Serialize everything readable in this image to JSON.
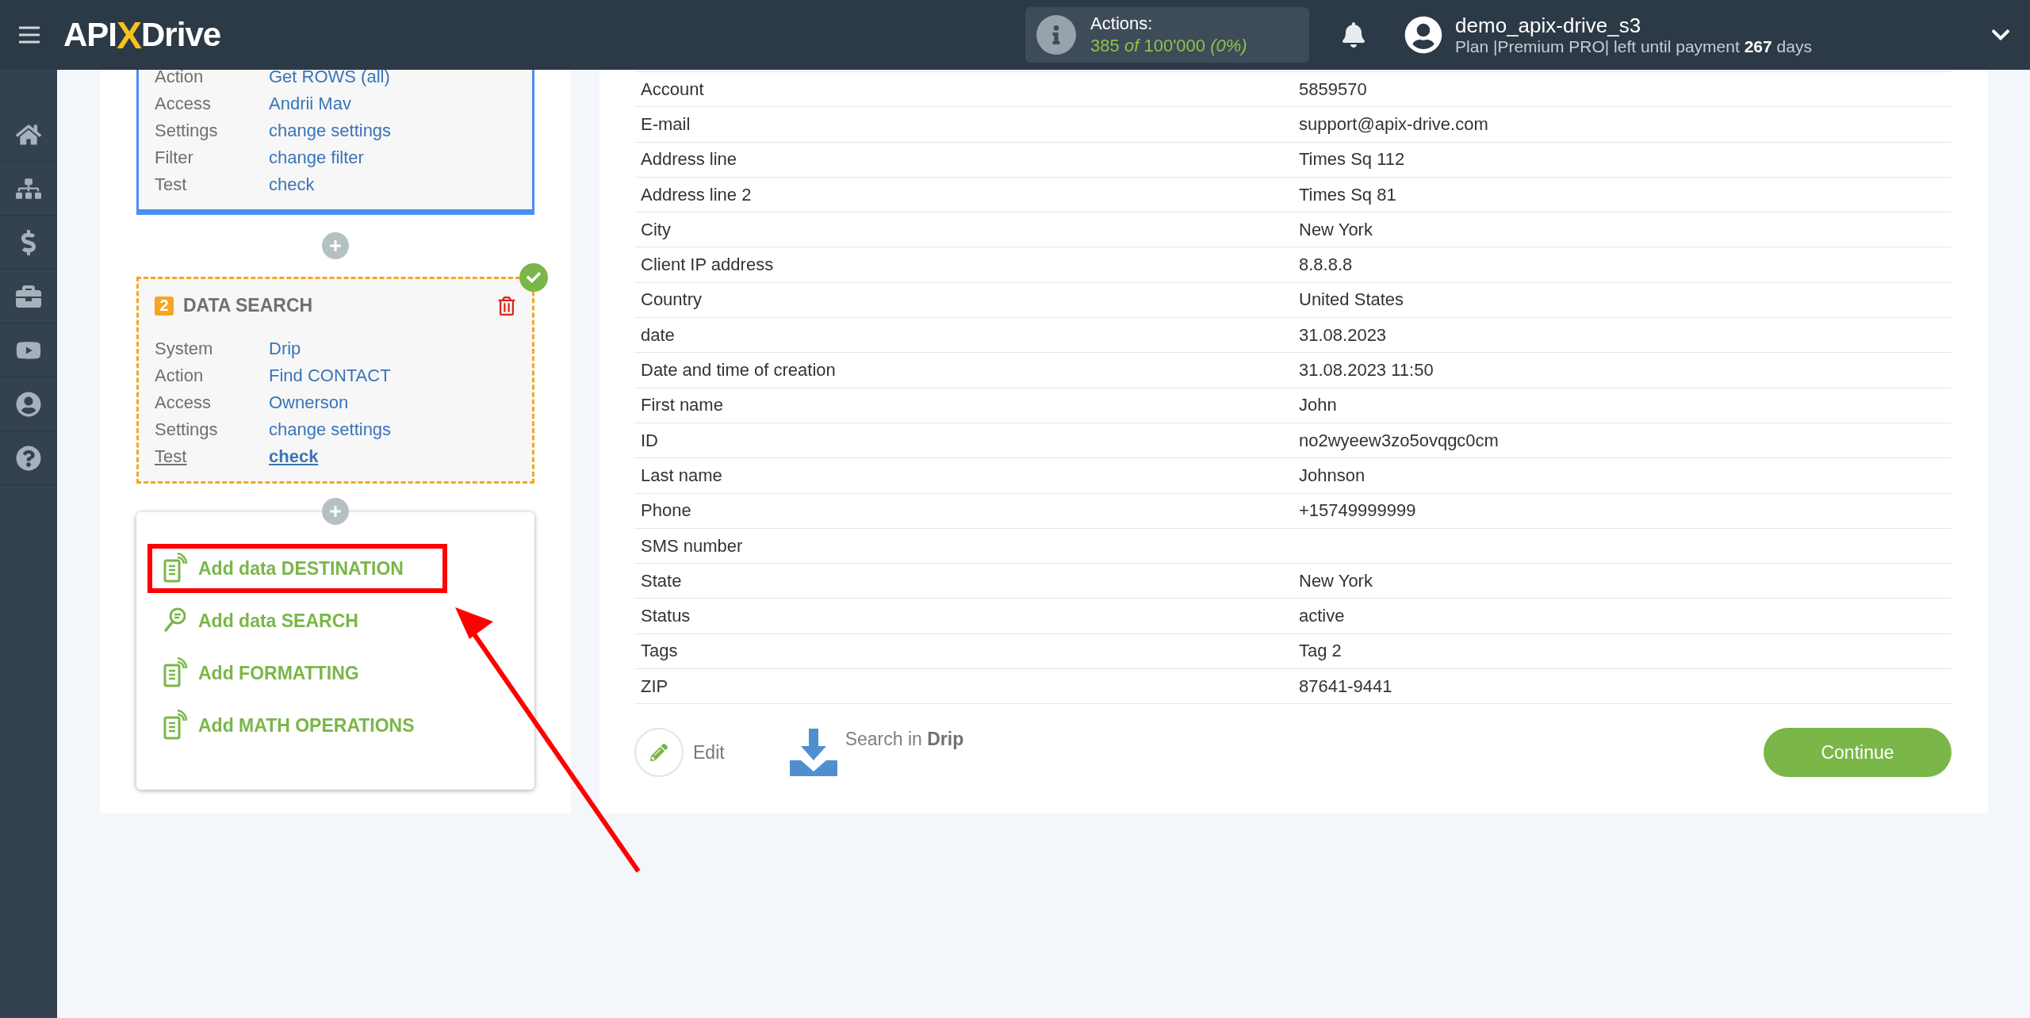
{
  "header": {
    "logo": {
      "left": "API",
      "mark": "X",
      "right": "Drive"
    },
    "actions": {
      "label": "Actions:",
      "used": "385",
      "of": "of",
      "total": "100'000",
      "percent": "(0%)"
    },
    "user": {
      "name": "demo_apix-drive_s3",
      "plan": "Plan |Premium PRO| left until payment **267** days"
    }
  },
  "sidebar": {
    "items": [
      {
        "kind": "home"
      },
      {
        "kind": "sitemap"
      },
      {
        "kind": "dollar"
      },
      {
        "kind": "briefcase"
      },
      {
        "kind": "video"
      },
      {
        "kind": "user"
      },
      {
        "kind": "help"
      }
    ]
  },
  "steps": [
    {
      "kind": "source",
      "rows": [
        {
          "label": "Action",
          "value": "Get ROWS (all)",
          "selected": false
        },
        {
          "label": "Access",
          "value": "Andrii Mav",
          "selected": false
        },
        {
          "label": "Settings",
          "value": "change settings",
          "selected": false
        },
        {
          "label": "Filter",
          "value": "change filter",
          "selected": false
        },
        {
          "label": "Test",
          "value": "check",
          "selected": false
        }
      ]
    },
    {
      "kind": "search",
      "number": "2",
      "title": "DATA SEARCH",
      "done": true,
      "rows": [
        {
          "label": "System",
          "value": "Drip",
          "selected": false
        },
        {
          "label": "Action",
          "value": "Find CONTACT",
          "selected": false
        },
        {
          "label": "Access",
          "value": "Ownerson",
          "selected": false
        },
        {
          "label": "Settings",
          "value": "change settings",
          "selected": false
        },
        {
          "label": "Test",
          "value": "check",
          "selected": true
        }
      ]
    }
  ],
  "add_menu": [
    {
      "kind": "document",
      "label": "Add data DESTINATION",
      "highlighted": true
    },
    {
      "kind": "search",
      "label": "Add data SEARCH",
      "highlighted": false
    },
    {
      "kind": "document",
      "label": "Add FORMATTING",
      "highlighted": false
    },
    {
      "kind": "document",
      "label": "Add MATH OPERATIONS",
      "highlighted": false
    }
  ],
  "table": {
    "rows": [
      {
        "field": "Account",
        "value": "5859570"
      },
      {
        "field": "E-mail",
        "value": "support@apix-drive.com"
      },
      {
        "field": "Address line",
        "value": "Times Sq 112"
      },
      {
        "field": "Address line 2",
        "value": "Times Sq 81"
      },
      {
        "field": "City",
        "value": "New York"
      },
      {
        "field": "Client IP address",
        "value": "8.8.8.8"
      },
      {
        "field": "Country",
        "value": "United States"
      },
      {
        "field": "date",
        "value": "31.08.2023"
      },
      {
        "field": "Date and time of creation",
        "value": "31.08.2023 11:50"
      },
      {
        "field": "First name",
        "value": "John"
      },
      {
        "field": "ID",
        "value": "no2wyeew3zo5ovqgc0cm"
      },
      {
        "field": "Last name",
        "value": "Johnson"
      },
      {
        "field": "Phone",
        "value": "+15749999999"
      },
      {
        "field": "SMS number",
        "value": ""
      },
      {
        "field": "State",
        "value": "New York"
      },
      {
        "field": "Status",
        "value": "active"
      },
      {
        "field": "Tags",
        "value": "Tag 2"
      },
      {
        "field": "ZIP",
        "value": "87641-9441"
      }
    ]
  },
  "footer": {
    "edit": "Edit",
    "search": "Search in **Drip**",
    "continue": "Continue"
  }
}
